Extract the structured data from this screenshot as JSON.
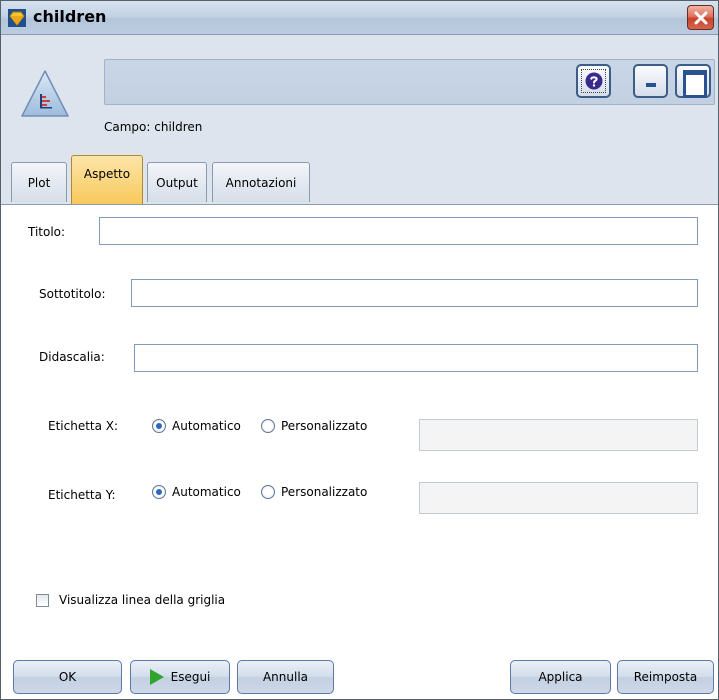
{
  "window": {
    "title": "children"
  },
  "header": {
    "field_label": "Campo: children"
  },
  "tabs": [
    {
      "label": "Plot"
    },
    {
      "label": "Aspetto"
    },
    {
      "label": "Output"
    },
    {
      "label": "Annotazioni"
    }
  ],
  "form": {
    "title_label": "Titolo:",
    "title_value": "",
    "subtitle_label": "Sottotitolo:",
    "subtitle_value": "",
    "caption_label": "Didascalia:",
    "caption_value": "",
    "xlabel": {
      "label": "Etichetta X:",
      "option_auto": "Automatico",
      "option_custom": "Personalizzato",
      "selected": "Automatico",
      "custom_value": ""
    },
    "ylabel": {
      "label": "Etichetta Y:",
      "option_auto": "Automatico",
      "option_custom": "Personalizzato",
      "selected": "Automatico",
      "custom_value": ""
    },
    "grid_label": "Visualizza linea della griglia",
    "grid_checked": false
  },
  "buttons": {
    "ok": "OK",
    "run": "Esegui",
    "cancel": "Annulla",
    "apply": "Applica",
    "reset": "Reimposta"
  },
  "colors": {
    "active_tab": "#f9c95c",
    "header_bg": "#dde4ee",
    "close_button": "#c9442c"
  }
}
